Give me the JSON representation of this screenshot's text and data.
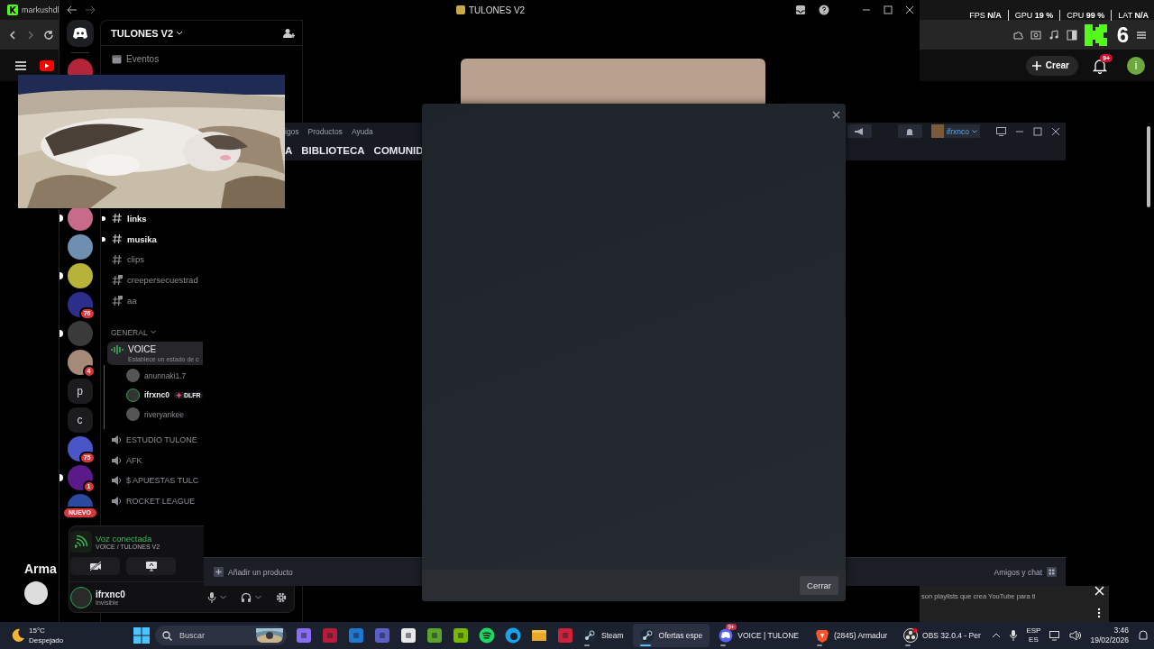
{
  "browser": {
    "tab_title": "markushdl",
    "kick_count": "6",
    "youtube": {
      "create_button": "Crear",
      "notification_badge": "9+",
      "avatar_letter": "i",
      "section_title": "Arma",
      "card_subtitle": "son playlists que crea YouTube para ti"
    }
  },
  "performance_overlay": [
    {
      "label": "FPS",
      "value": "N/A"
    },
    {
      "label": "GPU",
      "value": "19 %"
    },
    {
      "label": "CPU",
      "value": "99 %"
    },
    {
      "label": "LAT",
      "value": "N/A"
    }
  ],
  "discord": {
    "window_title": "TULONES V2",
    "server_name": "TULONES V2",
    "events": "Eventos",
    "servers": [
      {
        "kind": "avatar",
        "color": "#b3263a",
        "unread": false
      },
      {
        "kind": "avatar",
        "color": "#c86b8a",
        "unread": true
      },
      {
        "kind": "avatar",
        "color": "#6f8fb0",
        "unread": false
      },
      {
        "kind": "avatar",
        "color": "#b6b23a",
        "unread": true
      },
      {
        "kind": "avatar",
        "color": "#2b2f8a",
        "unread": false,
        "badge": "76"
      },
      {
        "kind": "avatar",
        "color": "#3a3a3a",
        "unread": true
      },
      {
        "kind": "avatar",
        "color": "#a58a78",
        "unread": false,
        "badge": "4"
      },
      {
        "kind": "letter",
        "letter": "p",
        "unread": false
      },
      {
        "kind": "letter",
        "letter": "c",
        "unread": false
      },
      {
        "kind": "avatar",
        "color": "#4a55c8",
        "unread": false,
        "badge": "75"
      },
      {
        "kind": "avatar",
        "color": "#5a1a8a",
        "unread": true,
        "badge": "1"
      },
      {
        "kind": "avatar",
        "color": "#2a4aa0",
        "unread": false,
        "badge": "NUEVO"
      }
    ],
    "channels": [
      {
        "kind": "text",
        "name": "links",
        "unread": true
      },
      {
        "kind": "text",
        "name": "musika",
        "unread": true
      },
      {
        "kind": "text",
        "name": "clips",
        "unread": false
      },
      {
        "kind": "private",
        "name": "creepersecuestrad",
        "unread": false
      },
      {
        "kind": "private",
        "name": "aa",
        "unread": false
      }
    ],
    "category": "GENERAL",
    "voice_channel": {
      "name": "VOICE",
      "status": "Establece un estado de c",
      "selected": true,
      "users": [
        {
          "name": "anunnaki1.7",
          "speaking": false
        },
        {
          "name": "ifrxnc0",
          "speaking": true,
          "tag": "DLFR"
        },
        {
          "name": "riveryankee",
          "speaking": false
        }
      ]
    },
    "voice_channels": [
      "ESTUDIO TULONE",
      "AFK",
      "$ APUESTAS TULC",
      "ROCKET LEAGUE"
    ],
    "voice_connection": {
      "status": "Voz conectada",
      "channel": "VOICE / TULONES V2"
    },
    "user": {
      "name": "ifrxnc0",
      "status": "Invisible"
    }
  },
  "steam": {
    "menu": [
      "igos",
      "Productos",
      "Ayuda"
    ],
    "nav": [
      "A",
      "BIBLIOTECA",
      "COMUNID"
    ],
    "username": "ifrxnco",
    "add_product": "Añadir un producto",
    "friends_chat": "Amigos y chat"
  },
  "dialog": {
    "close_button": "Cerrar"
  },
  "taskbar": {
    "temperature": "15°C",
    "weather": "Despejado",
    "search_placeholder": "Buscar",
    "apps": [
      {
        "kind": "steam",
        "label": "Steam",
        "selected": false
      },
      {
        "kind": "steam",
        "label": "Ofertas espe",
        "selected": true
      },
      {
        "kind": "discord",
        "label": "VOICE | TULONE",
        "selected": false,
        "badge": "9+"
      },
      {
        "kind": "brave",
        "label": "(2845) Armadur",
        "selected": false
      },
      {
        "kind": "obs",
        "label": "OBS 32.0.4 - Per",
        "selected": false
      }
    ],
    "input_language": "ESP",
    "keyboard_layout": "ES",
    "time": "3:46",
    "date": "19/02/2026"
  }
}
